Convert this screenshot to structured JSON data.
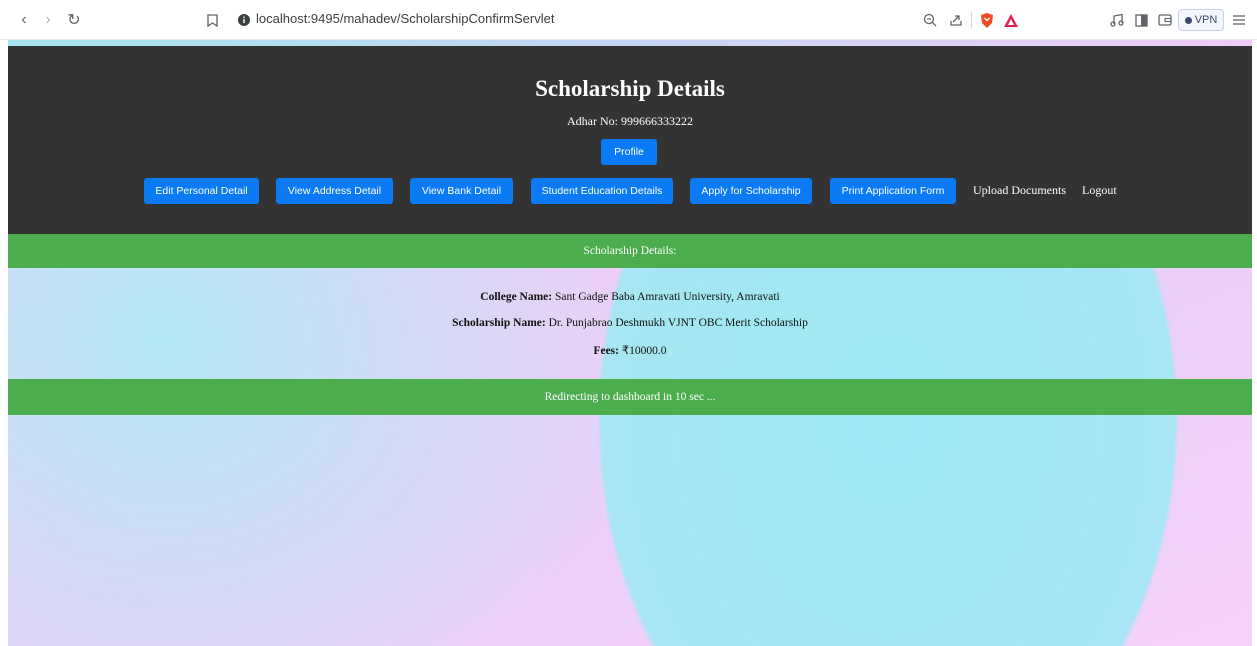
{
  "browser": {
    "url": "localhost:9495/mahadev/ScholarshipConfirmServlet",
    "vpn_label": "VPN"
  },
  "page": {
    "title": "Scholarship Details",
    "adhar_text": "Adhar No: 999666333222",
    "profile_label": "Profile",
    "nav_buttons": [
      "Edit Personal Detail",
      "View Address Detail",
      "View Bank Detail",
      "Student Education Details",
      "Apply for Scholarship",
      "Print Application Form"
    ],
    "nav_links": [
      "Upload Documents",
      "Logout"
    ],
    "section_heading": "Scholarship Details:",
    "college_label": "College Name:",
    "college_value": " Sant Gadge Baba Amravati University, Amravati",
    "scholarship_label": "Scholarship Name:",
    "scholarship_value": " Dr. Punjabrao Deshmukh VJNT OBC Merit Scholarship",
    "fees_label": "Fees:",
    "fees_value": " ₹10000.0",
    "redirect_text": "Redirecting to dashboard in 10 sec ..."
  },
  "colors": {
    "header_bg": "#333333",
    "button_blue": "#0b7af5",
    "bar_green": "#4cad4f"
  }
}
